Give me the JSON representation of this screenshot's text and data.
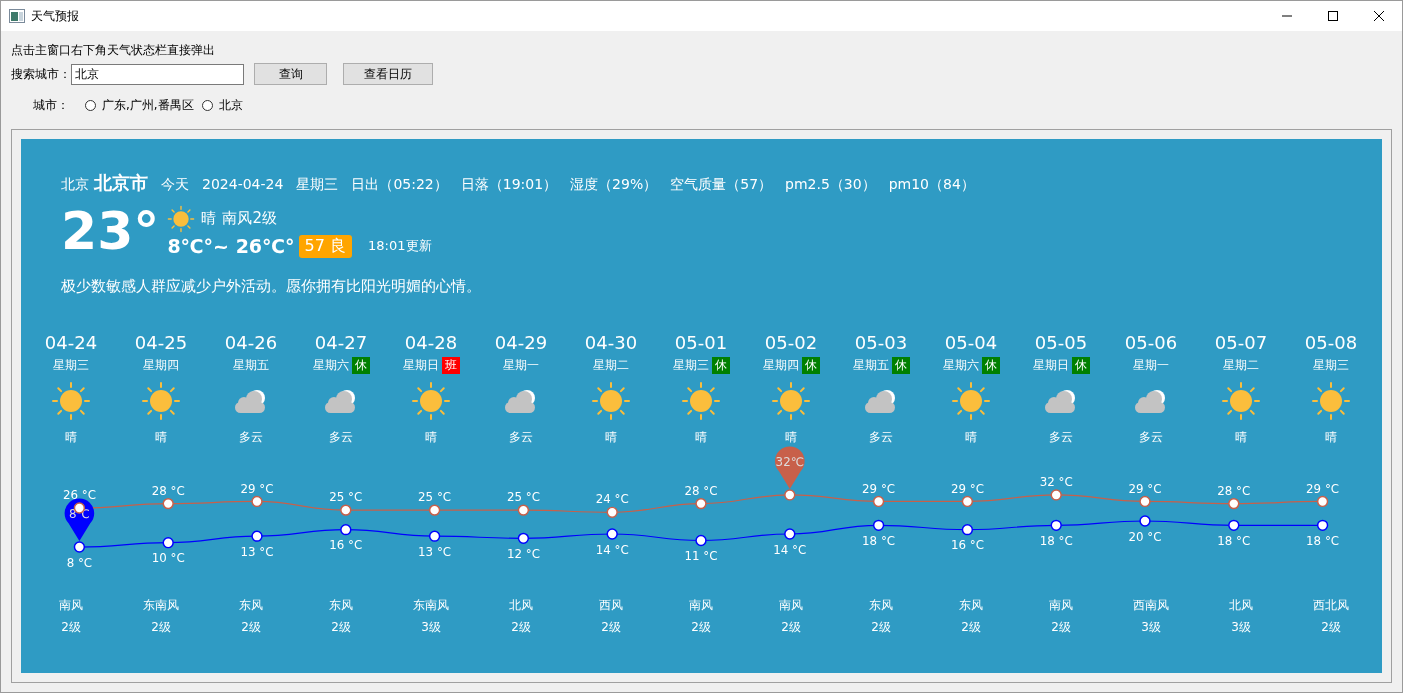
{
  "window": {
    "title": "天气预报"
  },
  "hint": "点击主窗口右下角天气状态栏直接弹出",
  "search": {
    "label": "搜索城市：",
    "value": "北京",
    "buttons": [
      "查询",
      "查看日历"
    ]
  },
  "cities": {
    "label": "城市：",
    "options": [
      {
        "label": "广东,广州,番禺区",
        "selected": false
      },
      {
        "label": "北京",
        "selected": false
      }
    ]
  },
  "current": {
    "city": "北京",
    "district": "北京市",
    "facts": [
      "今天",
      "2024-04-24",
      "星期三",
      "日出（05:22）",
      "日落（19:01）",
      "湿度（29%）",
      "空气质量（57）",
      "pm2.5（30）",
      "pm10（84）"
    ],
    "temp": "23°",
    "kind": "sun",
    "condition": "晴",
    "wind": "南风2级",
    "range": "8℃°~ 26℃°",
    "aqi_badge": "57 良",
    "updated": "18:01更新",
    "tip": "极少数敏感人群应减少户外活动。愿你拥有比阳光明媚的心情。"
  },
  "days": [
    {
      "weekday": "星期三",
      "kind": "sun",
      "condition": "晴",
      "wind": "南风",
      "level": "2级"
    },
    {
      "weekday": "星期四",
      "kind": "sun",
      "condition": "晴",
      "wind": "东南风",
      "level": "2级"
    },
    {
      "weekday": "星期五",
      "kind": "cloud",
      "condition": "多云",
      "wind": "东风",
      "level": "2级"
    },
    {
      "weekday": "星期六",
      "tag": {
        "text": "休",
        "kind": "rest"
      },
      "kind": "cloud",
      "condition": "多云",
      "wind": "东风",
      "level": "2级"
    },
    {
      "weekday": "星期日",
      "tag": {
        "text": "班",
        "kind": "work"
      },
      "kind": "sun",
      "condition": "晴",
      "wind": "东南风",
      "level": "3级"
    },
    {
      "weekday": "星期一",
      "kind": "cloud",
      "condition": "多云",
      "wind": "北风",
      "level": "2级"
    },
    {
      "weekday": "星期二",
      "kind": "sun",
      "condition": "晴",
      "wind": "西风",
      "level": "2级"
    },
    {
      "weekday": "星期三",
      "tag": {
        "text": "休",
        "kind": "rest"
      },
      "kind": "sun",
      "condition": "晴",
      "wind": "南风",
      "level": "2级"
    },
    {
      "weekday": "星期四",
      "tag": {
        "text": "休",
        "kind": "rest"
      },
      "kind": "sun",
      "condition": "晴",
      "wind": "南风",
      "level": "2级"
    },
    {
      "weekday": "星期五",
      "tag": {
        "text": "休",
        "kind": "rest"
      },
      "kind": "cloud",
      "condition": "多云",
      "wind": "东风",
      "level": "2级"
    },
    {
      "weekday": "星期六",
      "tag": {
        "text": "休",
        "kind": "rest"
      },
      "kind": "sun",
      "condition": "晴",
      "wind": "东风",
      "level": "2级"
    },
    {
      "weekday": "星期日",
      "tag": {
        "text": "休",
        "kind": "rest"
      },
      "kind": "cloud",
      "condition": "多云",
      "wind": "南风",
      "level": "2级"
    },
    {
      "weekday": "星期一",
      "kind": "cloud",
      "condition": "多云",
      "wind": "西南风",
      "level": "3级"
    },
    {
      "weekday": "星期二",
      "kind": "sun",
      "condition": "晴",
      "wind": "北风",
      "level": "3级"
    },
    {
      "weekday": "星期三",
      "kind": "sun",
      "condition": "晴",
      "wind": "西北风",
      "level": "2级"
    }
  ],
  "temperature_chart": {
    "chart_data": {
      "type": "line",
      "categories": [
        "04-24",
        "04-25",
        "04-26",
        "04-27",
        "04-28",
        "04-29",
        "04-30",
        "05-01",
        "05-02",
        "05-03",
        "05-04",
        "05-05",
        "05-06",
        "05-07",
        "05-08"
      ],
      "series": [
        {
          "color": "#c8604a",
          "marker": "circle",
          "values": [
            26,
            28,
            29,
            25,
            25,
            25,
            24,
            28,
            32,
            29,
            29,
            32,
            29,
            28,
            29
          ],
          "value_labels": [
            "26 °C",
            "28 °C",
            "29 °C",
            "25 °C",
            "25 °C",
            "25 °C",
            "24 °C",
            "28 °C",
            null,
            "29 °C",
            "29 °C",
            "32 °C",
            "29 °C",
            "28 °C",
            "29 °C"
          ]
        },
        {
          "color": "#0000ff",
          "marker": "circle",
          "values": [
            8,
            10,
            13,
            16,
            13,
            12,
            14,
            11,
            14,
            18,
            16,
            18,
            20,
            18,
            18
          ],
          "value_labels": [
            "8 °C",
            "10 °C",
            "13 °C",
            "16 °C",
            "13 °C",
            "12 °C",
            "14 °C",
            "11 °C",
            "14 °C",
            "18 °C",
            "16 °C",
            "18 °C",
            "20 °C",
            "18 °C",
            "18 °C"
          ]
        }
      ],
      "annotations": [
        {
          "text": "8℃",
          "x": "04-24",
          "y": 8
        },
        {
          "text": "32℃",
          "x": "05-02",
          "y": 32
        }
      ]
    }
  }
}
